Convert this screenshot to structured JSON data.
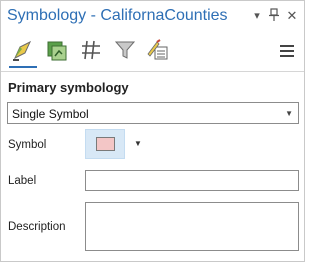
{
  "pane": {
    "title": "Symbology - CalifornaCounties",
    "controls": {
      "dropdown_icon": "triangle-down",
      "pin_icon": "pin",
      "close_icon": "close"
    }
  },
  "tabs": [
    {
      "name": "primary-symbology",
      "icon": "paint-brush-icon",
      "selected": true
    },
    {
      "name": "vary-symbology",
      "icon": "vary-symbology-icon",
      "selected": false
    },
    {
      "name": "label-classes",
      "icon": "hash-grid-icon",
      "selected": false
    },
    {
      "name": "filter",
      "icon": "funnel-icon",
      "selected": false
    },
    {
      "name": "advanced",
      "icon": "brush-list-icon",
      "selected": false
    }
  ],
  "colors": {
    "title": "#2e6fb5",
    "accent": "#2e6fb5",
    "symbol_fill": "#f3c6c6",
    "symbol_button_bg": "#d8e8f6"
  },
  "primary": {
    "heading": "Primary symbology",
    "method": {
      "selected": "Single Symbol"
    }
  },
  "fields": {
    "symbol_label": "Symbol",
    "label_label": "Label",
    "label_value": "",
    "description_label": "Description",
    "description_value": ""
  }
}
